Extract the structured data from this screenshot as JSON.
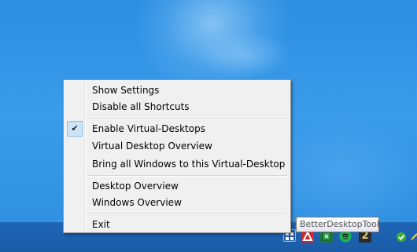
{
  "menu": {
    "items": [
      {
        "label": "Show Settings",
        "checked": false
      },
      {
        "label": "Disable all Shortcuts",
        "checked": false
      },
      {
        "label": "Enable Virtual-Desktops",
        "checked": true
      },
      {
        "label": "Virtual Desktop Overview",
        "checked": false
      },
      {
        "label": "Bring all Windows to this Virtual-Desktop",
        "checked": false
      },
      {
        "label": "Desktop Overview",
        "checked": false
      },
      {
        "label": "Windows Overview",
        "checked": false
      },
      {
        "label": "Exit",
        "checked": false
      }
    ],
    "check_glyph": "✔"
  },
  "tooltip": {
    "text": "BetterDesktopTool"
  },
  "tray": {
    "icons": [
      {
        "name": "betterdesktoptool-tray-icon",
        "color": "#cfd8e6"
      },
      {
        "name": "app-red-tray-icon",
        "color": "#d8232a"
      },
      {
        "name": "app-green-tray-icon",
        "color": "#1f7a3a"
      },
      {
        "name": "spotify-tray-icon",
        "color": "#1db954"
      },
      {
        "name": "app-number-tray-icon",
        "color": "#2a2a2a",
        "text": "2"
      },
      {
        "name": "security-check-tray-icon",
        "color": "#3fae3f"
      }
    ]
  },
  "colors": {
    "desktop": "#2f8fe0",
    "taskbar": "#1c5fab",
    "menu_bg": "#f0f0f0",
    "checked_bg": "#cde4f7"
  }
}
